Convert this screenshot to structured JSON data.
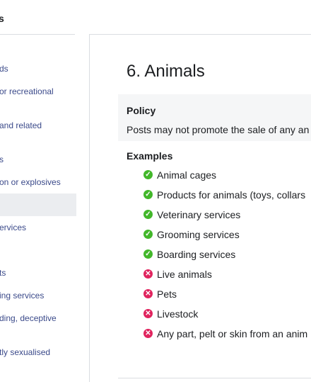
{
  "sidebar": {
    "heading": "s",
    "items": [
      {
        "label": "ds"
      },
      {
        "label": "or recreational"
      },
      {
        "label": "and related"
      },
      {
        "label": "s"
      },
      {
        "label": "on or explosives"
      },
      {
        "label": ""
      },
      {
        "label": "ervices"
      },
      {
        "label": "ts"
      },
      {
        "label": "ing services"
      },
      {
        "label": "ding, deceptive"
      },
      {
        "label": "tly sexualised"
      }
    ]
  },
  "main": {
    "title": "6. Animals",
    "policy_label": "Policy",
    "policy_text": "Posts may not promote the sale of any an",
    "examples_label": "Examples",
    "examples": [
      {
        "text": "Animal cages",
        "status": "allowed"
      },
      {
        "text": "Products for animals (toys, collars",
        "status": "allowed"
      },
      {
        "text": "Veterinary services",
        "status": "allowed"
      },
      {
        "text": "Grooming services",
        "status": "allowed"
      },
      {
        "text": "Boarding services",
        "status": "allowed"
      },
      {
        "text": "Live animals",
        "status": "prohibited"
      },
      {
        "text": "Pets",
        "status": "prohibited"
      },
      {
        "text": "Livestock",
        "status": "prohibited"
      },
      {
        "text": "Any part, pelt or skin from an anim",
        "status": "prohibited"
      }
    ]
  },
  "colors": {
    "allowed": "#42b72a",
    "prohibited": "#e0245e",
    "link": "#3b4a8a"
  },
  "icons": {
    "allowed": "check-circle-icon",
    "prohibited": "x-circle-icon"
  }
}
